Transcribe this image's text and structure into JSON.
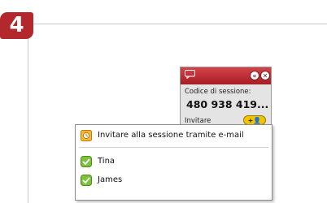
{
  "step": {
    "number": "4",
    "color": "#b3282d"
  },
  "widget": {
    "code_label": "Codice di sessione:",
    "code_value": "480 938 419...",
    "invite_label": "Invitare",
    "titlebar_color": "#b52a31",
    "icons": [
      "chat-bubble-icon",
      "back-icon",
      "close-icon",
      "add-person-icon"
    ]
  },
  "menu": {
    "email_item": "Invitare alla sessione tramite e-mail",
    "contacts": [
      {
        "name": "Tina",
        "icon": "online-status-icon"
      },
      {
        "name": "James",
        "icon": "online-status-icon"
      }
    ]
  }
}
